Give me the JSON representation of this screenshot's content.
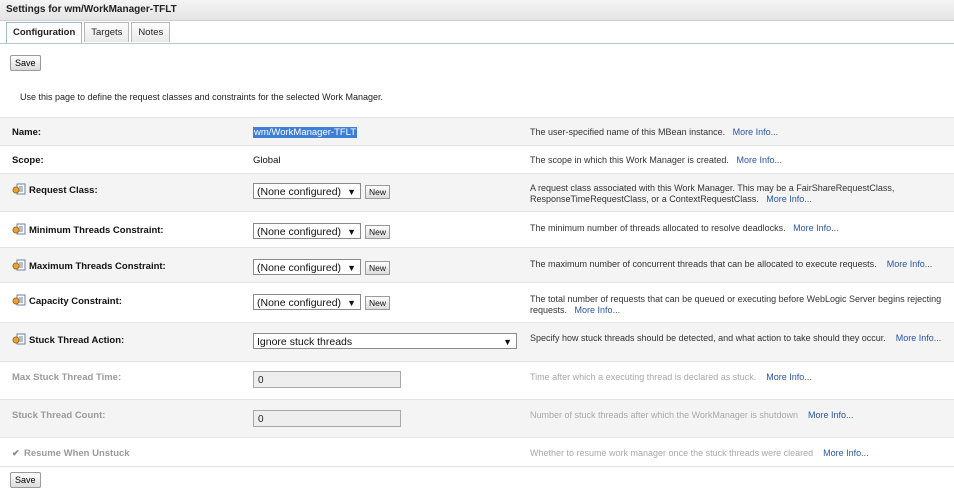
{
  "title": "Settings for wm/WorkManager-TFLT",
  "tabs": [
    {
      "label": "Configuration"
    },
    {
      "label": "Targets"
    },
    {
      "label": "Notes"
    }
  ],
  "save_label": "Save",
  "intro": "Use this page to define the request classes and constraints for the selected Work Manager.",
  "more_info": "More Info...",
  "new_label": "New",
  "rows": {
    "name": {
      "label": "Name:",
      "value": "wm/WorkManager-TFLT",
      "desc": "The user-specified name of this MBean instance."
    },
    "scope": {
      "label": "Scope:",
      "value": "Global",
      "desc": "The scope in which this Work Manager is created."
    },
    "request_class": {
      "label": "Request Class:",
      "value": "(None configured)",
      "desc": "A request class associated with this Work Manager. This may be a FairShareRequestClass, ResponseTimeRequestClass, or a ContextRequestClass."
    },
    "min_threads": {
      "label": "Minimum Threads Constraint:",
      "value": "(None configured)",
      "desc": "The minimum number of threads allocated to resolve deadlocks."
    },
    "max_threads": {
      "label": "Maximum Threads Constraint:",
      "value": "(None configured)",
      "desc": "The maximum number of concurrent threads that can be allocated to execute requests."
    },
    "capacity": {
      "label": "Capacity Constraint:",
      "value": "(None configured)",
      "desc": "The total number of requests that can be queued or executing before WebLogic Server begins rejecting requests."
    },
    "stuck_action": {
      "label": "Stuck Thread Action:",
      "value": "Ignore stuck threads",
      "desc": "Specify how stuck threads should be detected, and what action to take should they occur."
    },
    "max_stuck_time": {
      "label": "Max Stuck Thread Time:",
      "value": "0",
      "desc": "Time after which a executing thread is declared as stuck."
    },
    "stuck_count": {
      "label": "Stuck Thread Count:",
      "value": "0",
      "desc": "Number of stuck threads after which the WorkManager is shutdown"
    },
    "resume": {
      "label": "Resume When Unstuck",
      "checked": true,
      "desc": "Whether to resume work manager once the stuck threads were cleared"
    }
  }
}
